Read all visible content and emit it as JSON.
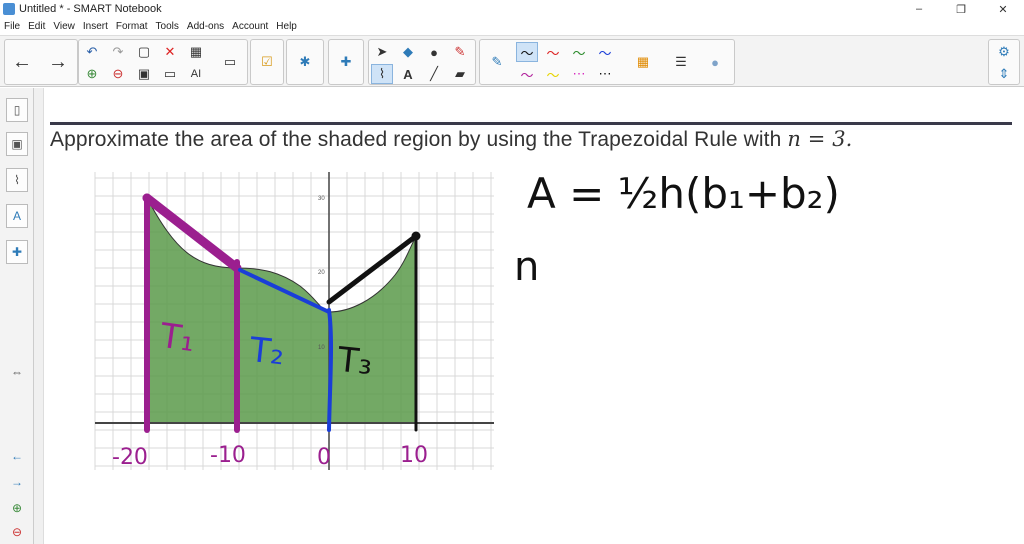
{
  "window": {
    "title": "Untitled * - SMART Notebook",
    "controls": [
      "–",
      "❐",
      "✕"
    ]
  },
  "menu": [
    "File",
    "Edit",
    "View",
    "Insert",
    "Format",
    "Tools",
    "Add-ons",
    "Account",
    "Help"
  ],
  "toolbar": {
    "icons": [
      "back-arrow-icon",
      "forward-arrow-icon",
      "undo-icon",
      "redo-icon",
      "clear-page-icon",
      "delete-icon",
      "table-icon",
      "screen-shade-icon",
      "magic-pen-icon",
      "activity-icon",
      "select-icon",
      "shapes-icon",
      "fill-icon",
      "eraser-icon",
      "pen-icon",
      "color-palette-icon",
      "line-style-icon",
      "properties-icon",
      "settings-gear-icon",
      "move-toolbar-icon"
    ]
  },
  "problem": {
    "text": "Approximate the area of the shaded region by using the Trapezoidal Rule with ",
    "math": "n = 3."
  },
  "annotations": {
    "formula": "A = ½h(b₁+b₂)",
    "t1": "T₁",
    "t2": "T₂",
    "t3": "T₃",
    "ticks": [
      "-20",
      "-10",
      "0",
      "10"
    ],
    "axis_ticks": [
      "30",
      "20",
      "10"
    ],
    "partial_letter": "n"
  },
  "colors": {
    "shade": "#5b9a4a",
    "purple": "#9b1f8f",
    "blue": "#1a3ed8",
    "black": "#111111",
    "toolbar_active": "#cfe3f7"
  }
}
